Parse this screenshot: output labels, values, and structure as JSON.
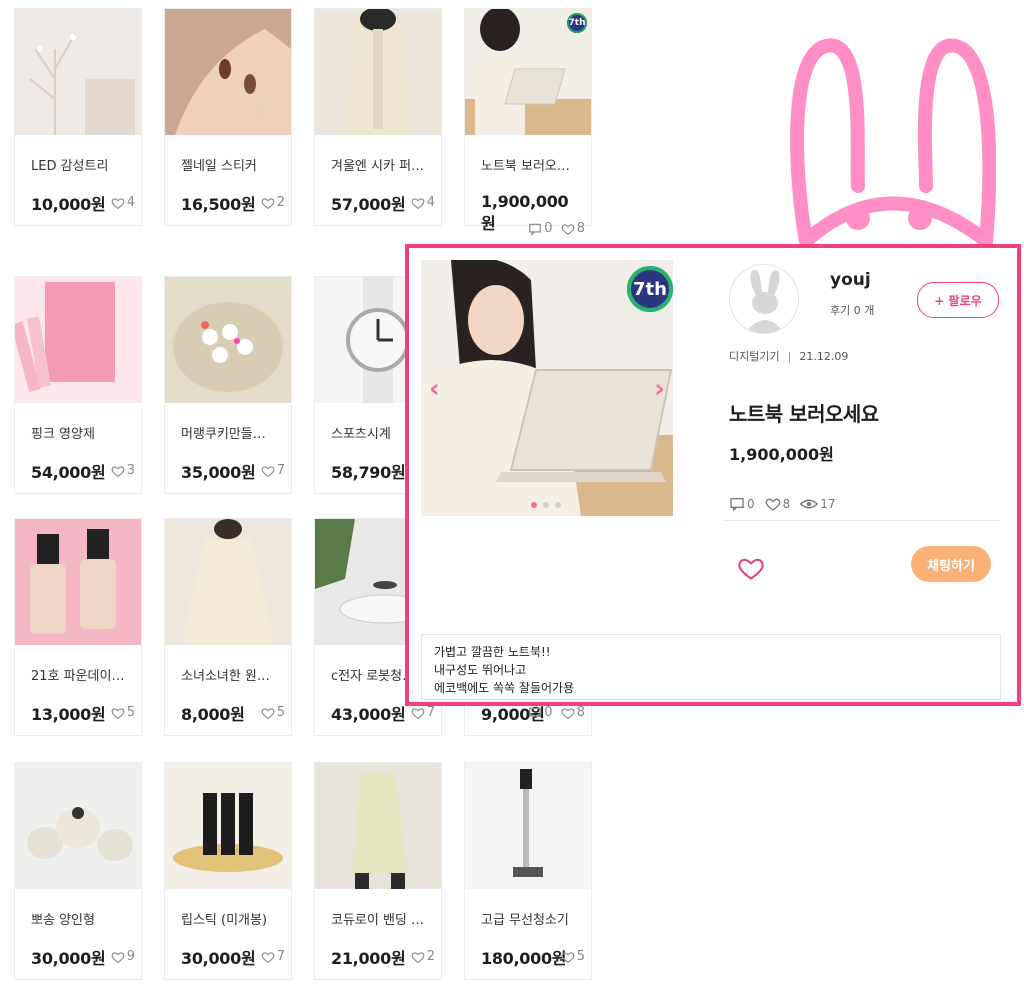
{
  "colors": {
    "accent": "#f2407e",
    "chat_button": "#fbb176",
    "bunny": "#ff8ec6"
  },
  "products": [
    {
      "title": "LED 감성트리",
      "price": "10,000원",
      "likes": "4",
      "img": "tree",
      "bg": "#eee7e4"
    },
    {
      "title": "젤네일 스티커",
      "price": "16,500원",
      "likes": "2",
      "img": "nail",
      "bg": "#c9a48c"
    },
    {
      "title": "겨울엔 시카 퍼…",
      "price": "57,000원",
      "likes": "4",
      "img": "jacket",
      "bg": "#ebe5dc"
    },
    {
      "title": "노트북 보러오…",
      "price": "1,900,000",
      "price2": "원",
      "comments": "0",
      "likes": "8",
      "img": "laptop",
      "bg": "#ece7df"
    },
    {
      "title": "핑크 영양제",
      "price": "54,000원",
      "likes": "3",
      "img": "pink",
      "bg": "#f7d5df"
    },
    {
      "title": "머랭쿠키만들…",
      "price": "35,000원",
      "likes": "7",
      "img": "cookie",
      "bg": "#e9e0cf"
    },
    {
      "title": "스포츠시계",
      "price": "58,790원",
      "likes": "",
      "img": "watch",
      "bg": "#f2f2f2"
    },
    {
      "title": "21호 파운데이…",
      "price": "13,000원",
      "likes": "5",
      "img": "foundation",
      "bg": "#f4b8c6"
    },
    {
      "title": "소녀소녀한 원…",
      "price": "8,000원",
      "likes": "5",
      "img": "dress",
      "bg": "#ede6dc"
    },
    {
      "title": "c전자 로봇청…",
      "price": "43,000원",
      "likes": "7",
      "img": "robot",
      "bg": "#e8e9e6"
    },
    {
      "title": "",
      "price": "9,000원",
      "comments": "0",
      "likes": "8",
      "img": "none",
      "bg": "#ffffff"
    },
    {
      "title": "뽀송 양인형",
      "price": "30,000원",
      "likes": "9",
      "img": "sheep",
      "bg": "#eef0ee"
    },
    {
      "title": "립스틱 (미개봉)",
      "price": "30,000원",
      "likes": "7",
      "img": "lipstick",
      "bg": "#f3eee6"
    },
    {
      "title": "코듀로이 밴딩 …",
      "price": "21,000원",
      "likes": "2",
      "img": "skirt",
      "bg": "#e7e2da"
    },
    {
      "title": "고급 무선청소기",
      "price": "180,000원",
      "likes": "5",
      "img": "vacuum",
      "bg": "#f5f5f5"
    }
  ],
  "popup": {
    "seller_name": "youj",
    "review_label": "후기 0 개",
    "follow_label": "+ 팔로우",
    "category": "디지털기기",
    "date": "21.12.09",
    "title": "노트북 보러오세요",
    "price": "1,900,000원",
    "comments": "0",
    "likes": "8",
    "views": "17",
    "chat_label": "채팅하기",
    "badge": "7th",
    "description": "가볍고 깔끔한 노트북!!\n내구성도 뛰어나고\n에코백에도 쏙쏙 잘들어가용"
  }
}
